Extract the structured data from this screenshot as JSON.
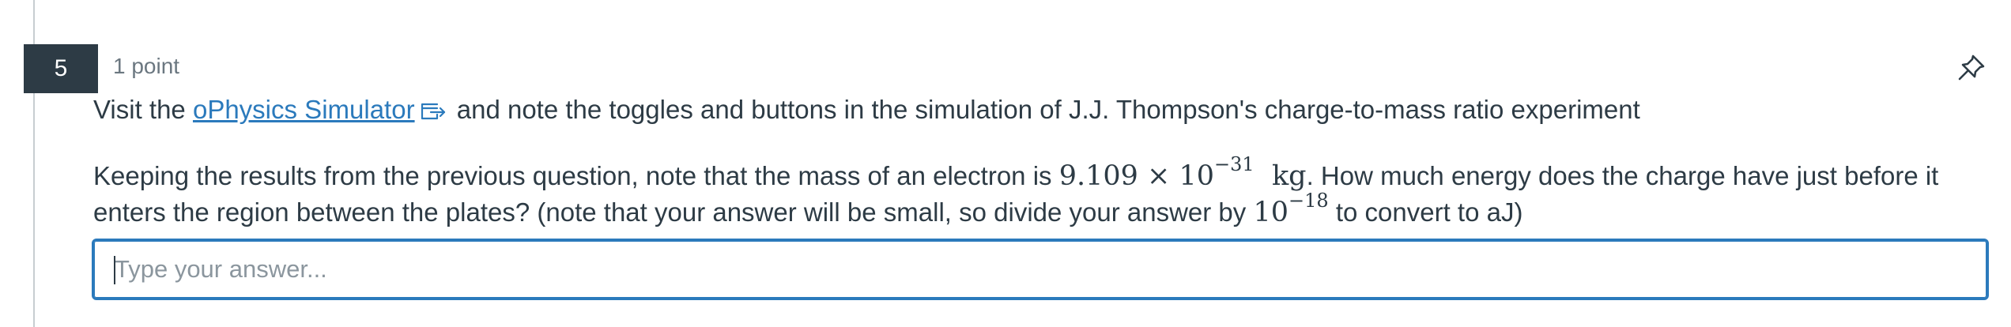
{
  "question": {
    "number": "5",
    "points": "1 point",
    "pin_icon": "pin-icon",
    "line1": {
      "prefix": "Visit the ",
      "link_text": "oPhysics Simulator",
      "link_icon": "external-link-icon",
      "suffix": " and note the toggles and buttons in the simulation of J.J. Thompson's charge-to-mass ratio experiment"
    },
    "body": {
      "part1": "Keeping the results from the previous question, note that the mass of an electron is ",
      "mass_mantissa": "9.109 × 10",
      "mass_exponent": "−31",
      "mass_unit": "kg",
      "part2": ". How much energy does the charge have just before it enters the region between the plates? (note that your answer will be small, so divide your answer by ",
      "divisor_base": "10",
      "divisor_exponent": "−18",
      "part3": " to convert to aJ)"
    },
    "answer": {
      "placeholder": "Type your answer...",
      "value": ""
    }
  },
  "colors": {
    "number_bg": "#2d3b45",
    "text": "#2d3b45",
    "muted": "#6b7780",
    "link": "#2b7abc",
    "focus_border": "#2b7abc"
  }
}
